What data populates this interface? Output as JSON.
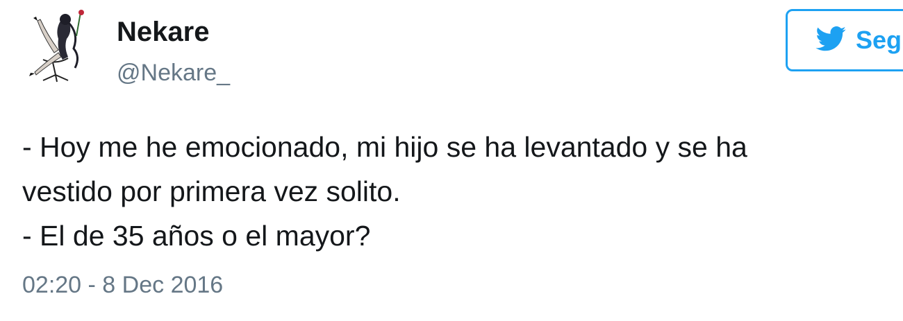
{
  "profile": {
    "display_name": "Nekare",
    "handle": "@Nekare_",
    "avatar_icon": "illustrated-woman-on-chair-avatar"
  },
  "follow_button": {
    "label": "Seg",
    "icon": "twitter-bird-icon",
    "color": "#1da1f2"
  },
  "tweet": {
    "lines": [
      "- Hoy me he emocionado, mi hijo se ha levantado y se ha",
      "vestido por primera vez solito.",
      "- El de 35 años o el mayor?"
    ],
    "timestamp": "02:20 - 8 Dec 2016"
  }
}
